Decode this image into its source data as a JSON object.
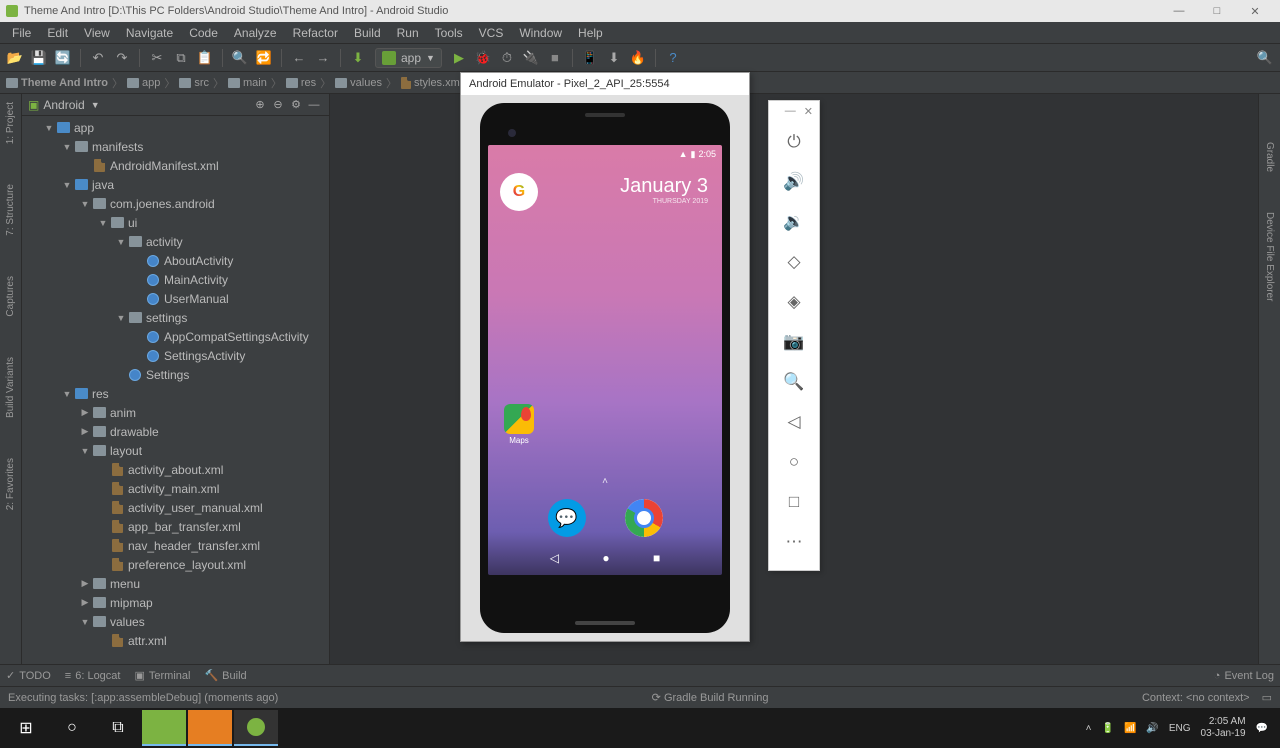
{
  "window": {
    "title": "Theme And Intro [D:\\This PC Folders\\Android Studio\\Theme And Intro] - Android Studio"
  },
  "menu": [
    "File",
    "Edit",
    "View",
    "Navigate",
    "Code",
    "Analyze",
    "Refactor",
    "Build",
    "Run",
    "Tools",
    "VCS",
    "Window",
    "Help"
  ],
  "run_config": {
    "label": "app"
  },
  "breadcrumb": [
    "Theme And Intro",
    "app",
    "src",
    "main",
    "res",
    "values",
    "styles.xml"
  ],
  "panel": {
    "title": "Android"
  },
  "tree": [
    {
      "d": 0,
      "a": "▼",
      "i": "folder-blue",
      "t": "app"
    },
    {
      "d": 1,
      "a": "▼",
      "i": "folder",
      "t": "manifests"
    },
    {
      "d": 2,
      "a": "",
      "i": "xml",
      "t": "AndroidManifest.xml"
    },
    {
      "d": 1,
      "a": "▼",
      "i": "folder-blue",
      "t": "java"
    },
    {
      "d": 2,
      "a": "▼",
      "i": "folder",
      "t": "com.joenes.android"
    },
    {
      "d": 3,
      "a": "▼",
      "i": "folder",
      "t": "ui"
    },
    {
      "d": 4,
      "a": "▼",
      "i": "folder",
      "t": "activity"
    },
    {
      "d": 5,
      "a": "",
      "i": "class",
      "t": "AboutActivity"
    },
    {
      "d": 5,
      "a": "",
      "i": "class",
      "t": "MainActivity"
    },
    {
      "d": 5,
      "a": "",
      "i": "class",
      "t": "UserManual"
    },
    {
      "d": 4,
      "a": "▼",
      "i": "folder",
      "t": "settings"
    },
    {
      "d": 5,
      "a": "",
      "i": "class",
      "t": "AppCompatSettingsActivity"
    },
    {
      "d": 5,
      "a": "",
      "i": "class",
      "t": "SettingsActivity"
    },
    {
      "d": 4,
      "a": "",
      "i": "class",
      "t": "Settings"
    },
    {
      "d": 1,
      "a": "▼",
      "i": "folder-blue",
      "t": "res"
    },
    {
      "d": 2,
      "a": "▶",
      "i": "folder",
      "t": "anim"
    },
    {
      "d": 2,
      "a": "▶",
      "i": "folder",
      "t": "drawable"
    },
    {
      "d": 2,
      "a": "▼",
      "i": "folder",
      "t": "layout"
    },
    {
      "d": 3,
      "a": "",
      "i": "xml",
      "t": "activity_about.xml"
    },
    {
      "d": 3,
      "a": "",
      "i": "xml",
      "t": "activity_main.xml"
    },
    {
      "d": 3,
      "a": "",
      "i": "xml",
      "t": "activity_user_manual.xml"
    },
    {
      "d": 3,
      "a": "",
      "i": "xml",
      "t": "app_bar_transfer.xml"
    },
    {
      "d": 3,
      "a": "",
      "i": "xml",
      "t": "nav_header_transfer.xml"
    },
    {
      "d": 3,
      "a": "",
      "i": "xml",
      "t": "preference_layout.xml"
    },
    {
      "d": 2,
      "a": "▶",
      "i": "folder",
      "t": "menu"
    },
    {
      "d": 2,
      "a": "▶",
      "i": "folder",
      "t": "mipmap"
    },
    {
      "d": 2,
      "a": "▼",
      "i": "folder",
      "t": "values"
    },
    {
      "d": 3,
      "a": "",
      "i": "xml",
      "t": "attr.xml"
    }
  ],
  "emulator": {
    "title": "Android Emulator - Pixel_2_API_25:5554",
    "status_time": "2:05",
    "date_big": "January 3",
    "date_small": "THURSDAY 2019",
    "maps_label": "Maps"
  },
  "bottom_tabs": [
    "TODO",
    "6: Logcat",
    "Terminal",
    "Build"
  ],
  "event_log": "Event Log",
  "status": {
    "left": "Executing tasks: [:app:assembleDebug] (moments ago)",
    "center": "Gradle Build Running",
    "context": "Context: <no context>"
  },
  "tray": {
    "time": "2:05 AM",
    "date": "03-Jan-19"
  },
  "side_tabs": {
    "project": "1: Project",
    "structure": "7: Structure",
    "captures": "Captures",
    "variants": "Build Variants",
    "favorites": "2: Favorites",
    "gradle": "Gradle",
    "device": "Device File Explorer"
  }
}
